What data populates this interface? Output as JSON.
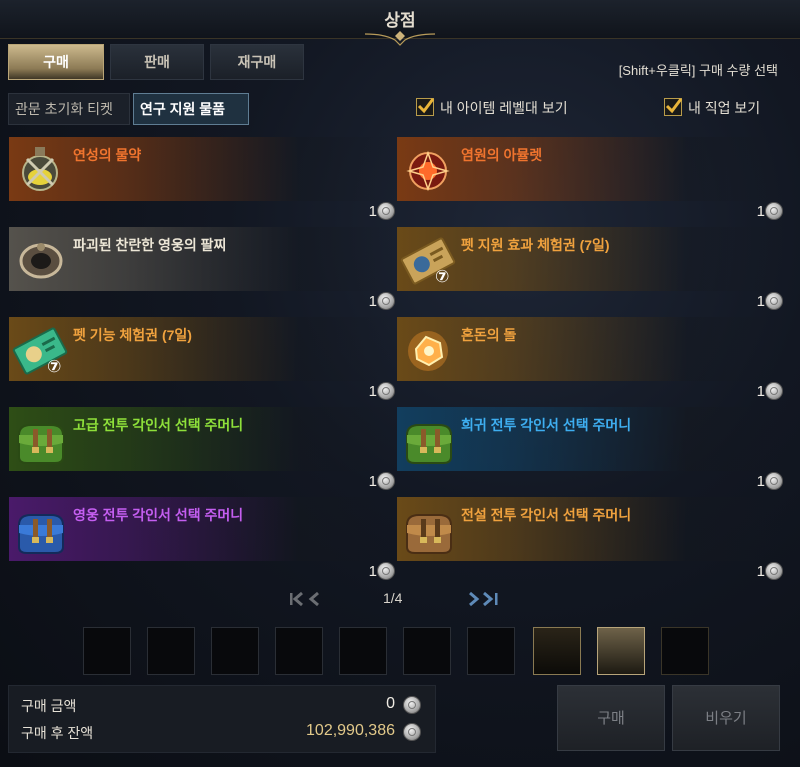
{
  "window": {
    "title": "상점"
  },
  "tabs": [
    {
      "label": "구매",
      "active": true
    },
    {
      "label": "판매",
      "active": false
    },
    {
      "label": "재구매",
      "active": false
    }
  ],
  "hint": "[Shift+우클릭] 구매 수량 선택",
  "subtabs": [
    {
      "label": "관문 초기화 티켓",
      "active": false
    },
    {
      "label": "연구 지원 물품",
      "active": true
    }
  ],
  "filters": [
    {
      "label": "내 아이템 레벨대 보기",
      "checked": true
    },
    {
      "label": "내 직업 보기",
      "checked": true
    }
  ],
  "items": [
    {
      "name": "연성의 물약",
      "price": "1",
      "color": "#f0742e",
      "grade_bg": "#7a3a14",
      "icon": "potion-icon"
    },
    {
      "name": "염원의 아뮬렛",
      "price": "1",
      "color": "#f0742e",
      "grade_bg": "#7a3a14",
      "icon": "amulet-icon"
    },
    {
      "name": "파괴된 찬란한 영웅의 팔찌",
      "price": "1",
      "color": "#ece6d6",
      "grade_bg": "#55524c",
      "icon": "bracelet-icon"
    },
    {
      "name": "펫 지원 효과 체험권 (7일)",
      "price": "1",
      "color": "#f0a23e",
      "grade_bg": "#6a4a18",
      "icon": "ticket-gold-icon",
      "badge": "⑦"
    },
    {
      "name": "펫 기능 체험권 (7일)",
      "price": "1",
      "color": "#f0a23e",
      "grade_bg": "#6a4a18",
      "icon": "ticket-green-icon",
      "badge": "⑦"
    },
    {
      "name": "혼돈의 돌",
      "price": "1",
      "color": "#f0a23e",
      "grade_bg": "#6a4a18",
      "icon": "chaos-stone-icon"
    },
    {
      "name": "고급 전투 각인서 선택 주머니",
      "price": "1",
      "color": "#8ee03a",
      "grade_bg": "#2e4e16",
      "icon": "pouch-green-icon"
    },
    {
      "name": "희귀 전투 각인서 선택 주머니",
      "price": "1",
      "color": "#3eaef0",
      "grade_bg": "#123e5e",
      "icon": "pouch-green-icon"
    },
    {
      "name": "영웅 전투 각인서 선택 주머니",
      "price": "1",
      "color": "#c45ef0",
      "grade_bg": "#4a1a6a",
      "icon": "pouch-blue-icon"
    },
    {
      "name": "전설 전투 각인서 선택 주머니",
      "price": "1",
      "color": "#f0a23e",
      "grade_bg": "#6a4a18",
      "icon": "pouch-brown-icon"
    }
  ],
  "pager": {
    "current": "1/4"
  },
  "footer": {
    "purchase_amount_label": "구매 금액",
    "purchase_amount": "0",
    "balance_label": "구매 후 잔액",
    "balance": "102,990,386",
    "buy_label": "구매",
    "clear_label": "비우기"
  }
}
